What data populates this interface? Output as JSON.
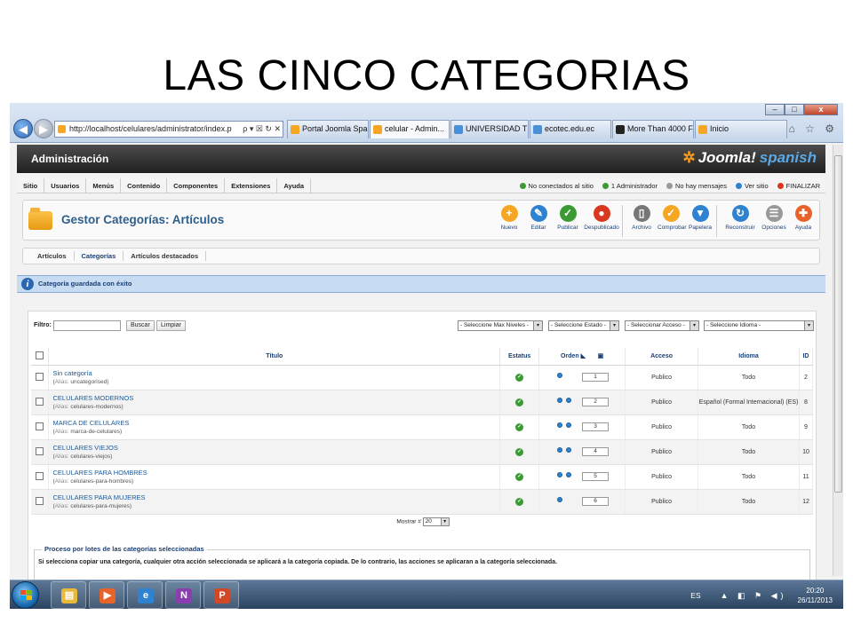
{
  "slide": {
    "title": "LAS CINCO CATEGORIAS"
  },
  "browser": {
    "window_buttons": [
      "–",
      "□",
      "x"
    ],
    "address": "http://localhost/celulares/administrator/index.p",
    "address_tools": "ρ ▾ ☒ ↻ ✕",
    "tabs": [
      {
        "label": "Portal Joomla Spa...",
        "color": "#f5a623"
      },
      {
        "label": "celular - Admin...",
        "color": "#f5a623",
        "active": true
      },
      {
        "label": "UNIVERSIDAD TEC...",
        "color": "#4a90d9"
      },
      {
        "label": "ecotec.edu.ec",
        "color": "#4a90d9"
      },
      {
        "label": "More Than 4000 Fr...",
        "color": "#222222"
      },
      {
        "label": "Inicio",
        "color": "#f5a623"
      }
    ],
    "right_icons": "⌂ ☆ ⚙"
  },
  "admin": {
    "header_title": "Administración",
    "logo_text": "Joomla!",
    "logo_sub": "spanish",
    "menu": [
      "Sitio",
      "Usuarios",
      "Menús",
      "Contenido",
      "Componentes",
      "Extensiones",
      "Ayuda"
    ],
    "status": [
      {
        "label": "No conectados al sitio",
        "color": "#3c9a35"
      },
      {
        "label": "1 Administrador",
        "color": "#3c9a35"
      },
      {
        "label": "No hay mensajes",
        "color": "#999999"
      },
      {
        "label": "Ver sitio",
        "color": "#2e82d0"
      },
      {
        "label": "FINALIZAR",
        "color": "#d9381e"
      }
    ],
    "page_title": "Gestor Categorías: Artículos",
    "toolbar": [
      {
        "label": "Nuevo",
        "icon": "+",
        "color": "#f5a623"
      },
      {
        "label": "Editar",
        "icon": "✎",
        "color": "#2e82d0"
      },
      {
        "label": "Publicar",
        "icon": "✓",
        "color": "#3c9a35"
      },
      {
        "label": "Despublicado",
        "icon": "●",
        "color": "#d9381e"
      },
      {
        "label": "Archivo",
        "icon": "▯",
        "color": "#777777"
      },
      {
        "label": "Comprobar",
        "icon": "✓",
        "color": "#f5a623"
      },
      {
        "label": "Papelera",
        "icon": "▼",
        "color": "#2e82d0"
      },
      {
        "label": "Reconstruir",
        "icon": "↻",
        "color": "#2e82d0"
      },
      {
        "label": "Opciones",
        "icon": "☰",
        "color": "#999999"
      },
      {
        "label": "Ayuda",
        "icon": "✚",
        "color": "#e8632a"
      }
    ],
    "subnav": [
      "Artículos",
      "Categorías",
      "Artículos destacados"
    ],
    "message": "Categoría guardada con éxito",
    "filter": {
      "label": "Filtro:",
      "search_button": "Buscar",
      "clear_button": "Limpiar",
      "selects": [
        "- Seleccione Max Niveles -",
        "- Seleccione Estado -",
        "- Seleccionar Acceso -",
        "- Seleccione Idioma -"
      ]
    },
    "columns": {
      "title": "Título",
      "status": "Estatus",
      "order": "Orden",
      "access": "Acceso",
      "language": "Idioma",
      "id": "ID"
    },
    "rows": [
      {
        "title": "Sin categoría",
        "alias_label": "Alias:",
        "alias": "uncategorised",
        "order": "1",
        "access": "Publico",
        "language": "Todo",
        "id": "2",
        "arrows": 1
      },
      {
        "title": "CELULARES MODERNOS",
        "alias_label": "Alias:",
        "alias": "celulares-modernos",
        "order": "2",
        "access": "Publico",
        "language": "Español (Formal Internacional) (ES)",
        "id": "8",
        "arrows": 2
      },
      {
        "title": "MARCA DE CELULARES",
        "alias_label": "Alias:",
        "alias": "marca-de-celulares",
        "order": "3",
        "access": "Publico",
        "language": "Todo",
        "id": "9",
        "arrows": 2
      },
      {
        "title": "CELULARES VIEJOS",
        "alias_label": "Alias:",
        "alias": "celulares-viejos",
        "order": "4",
        "access": "Publico",
        "language": "Todo",
        "id": "10",
        "arrows": 2
      },
      {
        "title": "CELULARES PARA HOMBRES",
        "alias_label": "Alias:",
        "alias": "celulares-para-hombres",
        "order": "5",
        "access": "Publico",
        "language": "Todo",
        "id": "11",
        "arrows": 2
      },
      {
        "title": "CELULARES PARA MUJERES",
        "alias_label": "Alias:",
        "alias": "celulares-para-mujeres",
        "order": "6",
        "access": "Publico",
        "language": "Todo",
        "id": "12",
        "arrows": 1
      }
    ],
    "pager": {
      "label": "Mostrar #",
      "value": "20"
    },
    "batch": {
      "legend": "Proceso por lotes de las categorías seleccionadas",
      "text": "Si selecciona copiar una categoría, cualquier otra acción seleccionada se aplicará a la categoría copiada. De lo contrario, las acciones se aplicaran a la categoría seleccionada."
    }
  },
  "taskbar": {
    "apps": [
      {
        "name": "explorer",
        "color": "#e8b93a",
        "glyph": "▤"
      },
      {
        "name": "media-player",
        "color": "#e8632a",
        "glyph": "▶"
      },
      {
        "name": "internet-explorer",
        "color": "#2e82d0",
        "glyph": "e"
      },
      {
        "name": "onenote",
        "color": "#8a3fb0",
        "glyph": "N"
      },
      {
        "name": "powerpoint",
        "color": "#d24726",
        "glyph": "P"
      }
    ],
    "lang": "ES",
    "tray_icons": "▲ ◧ ⚑ ◀)",
    "time": "20:20",
    "date": "26/11/2013"
  }
}
